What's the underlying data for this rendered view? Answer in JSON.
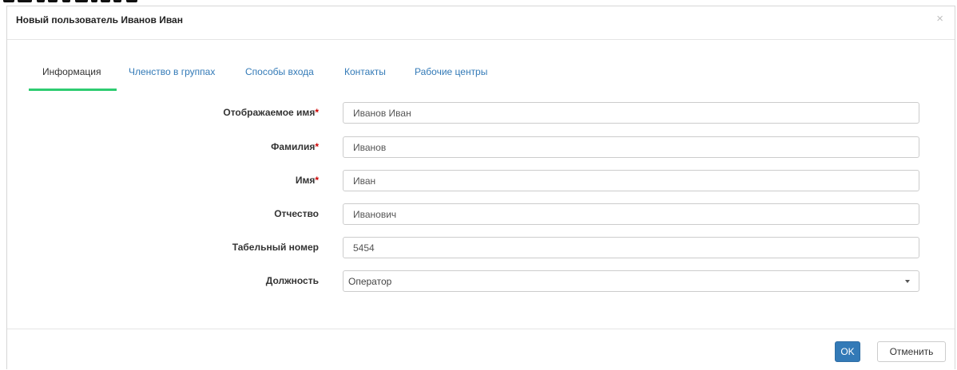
{
  "dialog": {
    "title": "Новый пользователь Иванов Иван",
    "close_glyph": "×"
  },
  "tabs": [
    {
      "label": "Информация",
      "active": true
    },
    {
      "label": "Членство в группах",
      "active": false
    },
    {
      "label": "Способы входа",
      "active": false
    },
    {
      "label": "Контакты",
      "active": false
    },
    {
      "label": "Рабочие центры",
      "active": false
    }
  ],
  "form": {
    "required_mark": "*",
    "display_name": {
      "label": "Отображаемое имя",
      "value": "Иванов Иван",
      "required": true
    },
    "last_name": {
      "label": "Фамилия",
      "value": "Иванов",
      "required": true
    },
    "first_name": {
      "label": "Имя",
      "value": "Иван",
      "required": true
    },
    "middle_name": {
      "label": "Отчество",
      "value": "Иванович",
      "required": false
    },
    "employee_number": {
      "label": "Табельный номер",
      "value": "5454",
      "required": false
    },
    "position": {
      "label": "Должность",
      "value": "Оператор",
      "required": false
    }
  },
  "footer": {
    "ok_label": "OK",
    "cancel_label": "Отменить"
  },
  "colors": {
    "primary": "#337ab7",
    "active_tab_underline": "#2ecc71",
    "required": "#cc0000"
  }
}
